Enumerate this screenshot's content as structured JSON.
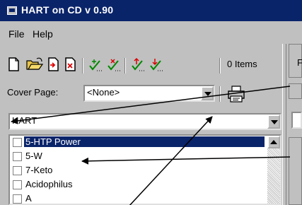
{
  "window": {
    "title": "HART on CD v 0.90"
  },
  "menu": {
    "items": [
      "File",
      "Help"
    ]
  },
  "toolbar": {
    "buttons": [
      {
        "name": "new-icon"
      },
      {
        "name": "open-folder-icon"
      },
      {
        "name": "import-icon"
      },
      {
        "name": "delete-icon"
      },
      {
        "name": "check-all-icon"
      },
      {
        "name": "uncheck-all-icon"
      },
      {
        "name": "check-up-icon"
      },
      {
        "name": "check-down-icon"
      }
    ],
    "items_count": "0 Items"
  },
  "cover_page": {
    "label": "Cover Page:",
    "value": "<None>"
  },
  "category": {
    "value": "HART"
  },
  "list": {
    "items": [
      {
        "label": "5-HTP Power",
        "selected": true
      },
      {
        "label": "5-W",
        "selected": false
      },
      {
        "label": "7-Keto",
        "selected": false
      },
      {
        "label": "Acidophilus",
        "selected": false
      },
      {
        "label": "A",
        "selected": false
      }
    ]
  },
  "right_pane": {
    "label": "F"
  },
  "colors": {
    "title_bg": "#0a246a",
    "window_bg": "#c0c0c0",
    "selection_bg": "#0a246a"
  }
}
